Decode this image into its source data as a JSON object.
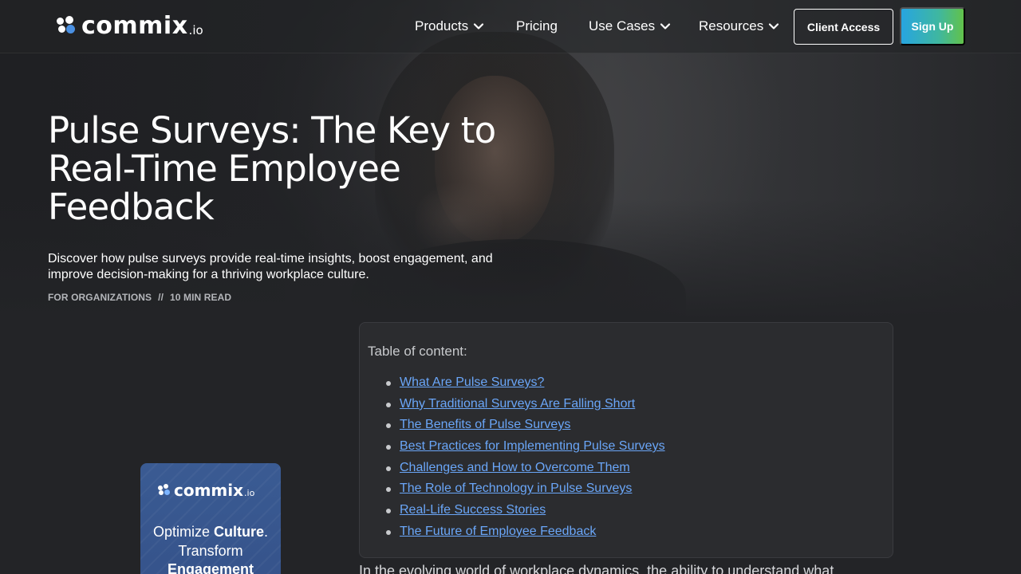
{
  "brand": {
    "name": "commix",
    "tld": ".io",
    "accent": "#4a90e2"
  },
  "nav": {
    "items": [
      {
        "label": "Products",
        "has_dropdown": true
      },
      {
        "label": "Pricing",
        "has_dropdown": false
      },
      {
        "label": "Use Cases",
        "has_dropdown": true
      },
      {
        "label": "Resources",
        "has_dropdown": true
      }
    ],
    "client_access": "Client Access",
    "sign_up": "Sign Up"
  },
  "hero": {
    "title": "Pulse Surveys: The Key to Real-Time Employee Feedback",
    "subtitle": "Discover how pulse surveys provide real-time insights, boost engagement, and improve decision-making for a thriving workplace culture.",
    "category": "FOR ORGANIZATIONS",
    "separator": "//",
    "read_time": "10 MIN READ"
  },
  "toc": {
    "title": "Table of content:",
    "items": [
      "What Are Pulse Surveys?",
      "Why Traditional Surveys Are Falling Short",
      "The Benefits of Pulse Surveys",
      "Best Practices for Implementing Pulse Surveys",
      "Challenges and How to Overcome Them",
      "The Role of Technology in Pulse Surveys",
      "Real-Life Success Stories",
      "The Future of Employee Feedback"
    ],
    "link_color": "#6aa6f8"
  },
  "article": {
    "intro": "In the evolving world of workplace dynamics, the ability to understand what"
  },
  "promo": {
    "brand": "commix",
    "tld": ".io",
    "line1_pre": "Optimize ",
    "line1_bold": "Culture",
    "line1_post": ".",
    "line2": "Transform",
    "line3_bold": "Engagement"
  }
}
